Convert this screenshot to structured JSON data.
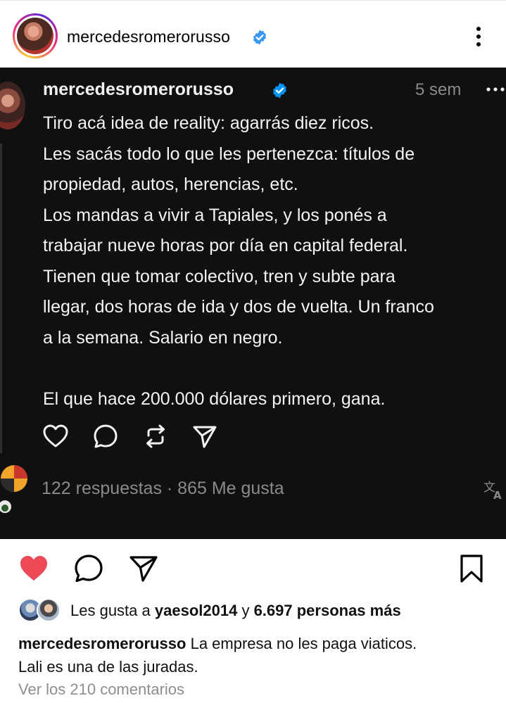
{
  "post": {
    "username": "mercedesromerorusso",
    "verified_icon": "verified-badge-icon",
    "more_icon": "vertical-ellipsis-icon"
  },
  "thread": {
    "username": "mercedesromerorusso",
    "time": "5 sem",
    "body_lines": [
      "Tiro acá idea de reality: agarrás diez ricos.",
      "Les sacás todo lo que les pertenezca: títulos de",
      "propiedad, autos, herencias, etc.",
      "Los mandas a vivir a Tapiales, y los ponés a",
      "trabajar nueve horas por día en capital federal.",
      "Tienen que tomar colectivo, tren y subte para",
      "llegar, dos horas de ida y dos de vuelta. Un franco",
      "a la semana. Salario en negro.",
      "El que hace 200.000 dólares primero, gana."
    ],
    "stats": "122 respuestas · 865 Me gusta",
    "actions": [
      "heart-icon",
      "comment-icon",
      "repost-icon",
      "share-icon"
    ],
    "translate_icon": "translate-icon"
  },
  "actions": {
    "like_icon": "heart-filled-icon",
    "like_color": "#ed4956",
    "comment_icon": "comment-icon",
    "share_icon": "send-icon",
    "save_icon": "bookmark-icon"
  },
  "likes": {
    "prefix": "Les gusta a",
    "user": "yaesol2014",
    "conj": "y",
    "others": "6.697 personas más"
  },
  "caption": {
    "username": "mercedesromerorusso",
    "line1": "La empresa no les paga viaticos.",
    "line2": "Lali es una de las juradas."
  },
  "comments_link": "Ver los 210 comentarios"
}
